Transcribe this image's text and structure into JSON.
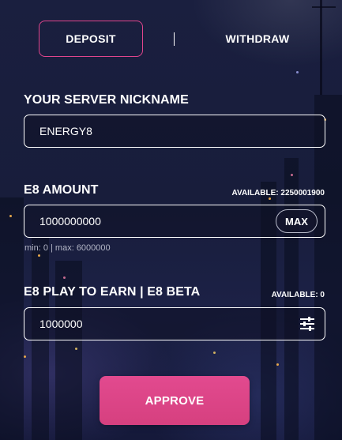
{
  "tabs": [
    {
      "label": "DEPOSIT",
      "active": true
    },
    {
      "label": "WITHDRAW",
      "active": false
    }
  ],
  "nickname": {
    "label": "YOUR SERVER NICKNAME",
    "value": "ENERGY8"
  },
  "amount": {
    "label": "E8 AMOUNT",
    "available": "AVAILABLE: 2250001900",
    "value": "1000000000",
    "max_label": "MAX",
    "hint": "min: 0 | max: 6000000"
  },
  "play": {
    "label": "E8 PLAY TO EARN | E8 BETA",
    "available": "AVAILABLE: 0",
    "value": "1000000",
    "icon": "tune-icon"
  },
  "approve_label": "APPROVE",
  "colors": {
    "accent": "#e0458c",
    "button": "#dc4586",
    "background": "#1a1f3f"
  }
}
